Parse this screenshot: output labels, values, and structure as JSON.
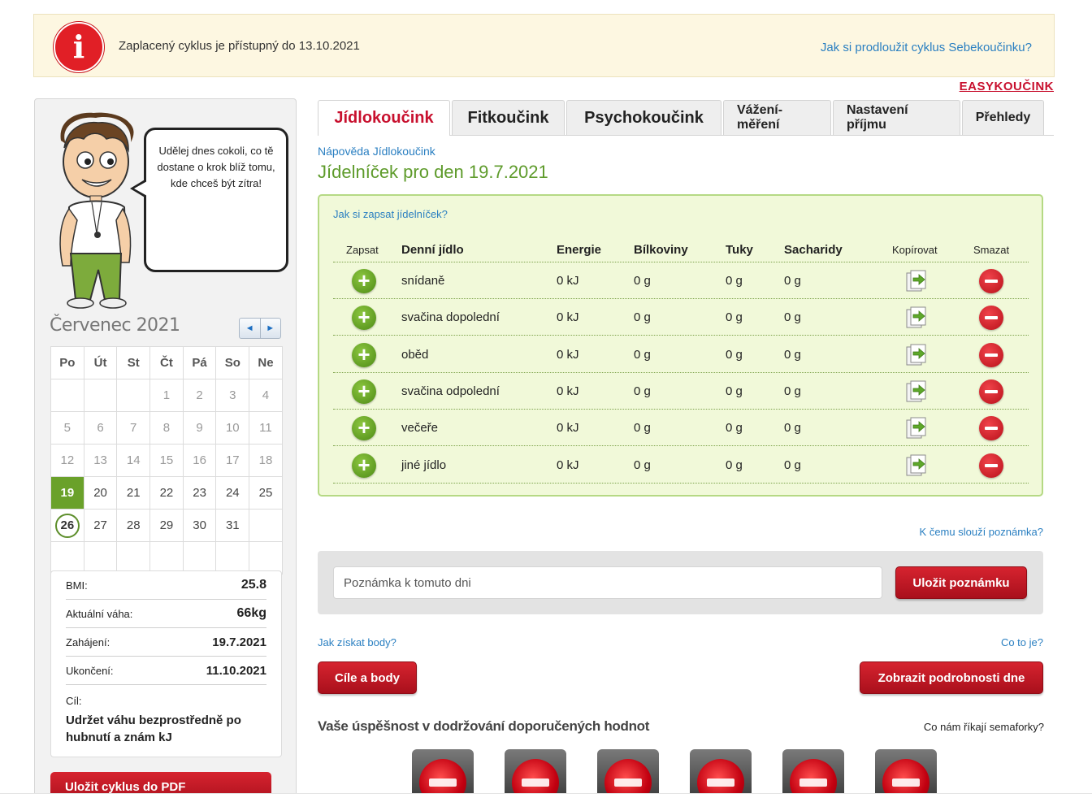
{
  "banner": {
    "icon": "info-icon",
    "icon_glyph": "i",
    "text": "Zaplacený cyklus je přístupný do 13.10.2021",
    "link": "Jak si prodloužit cyklus Sebekoučinku?"
  },
  "easy_link": "EASYKOUČINK",
  "coach": {
    "bubble": "Udělej dnes cokoli, co tě dostane o krok blíž tomu, kde chceš být zítra!"
  },
  "calendar": {
    "month": "Červenec 2021",
    "prev_glyph": "◄",
    "next_glyph": "►",
    "weekdays": [
      "Po",
      "Út",
      "St",
      "Čt",
      "Pá",
      "So",
      "Ne"
    ],
    "weeks": [
      [
        "",
        "",
        "",
        "1",
        "2",
        "3",
        "4"
      ],
      [
        "5",
        "6",
        "7",
        "8",
        "9",
        "10",
        "11"
      ],
      [
        "12",
        "13",
        "14",
        "15",
        "16",
        "17",
        "18"
      ],
      [
        "19",
        "20",
        "21",
        "22",
        "23",
        "24",
        "25"
      ],
      [
        "26",
        "27",
        "28",
        "29",
        "30",
        "31",
        ""
      ],
      [
        "",
        "",
        "",
        "",
        "",
        "",
        ""
      ]
    ],
    "selected_day": "19",
    "today": "26"
  },
  "stats": {
    "bmi_label": "BMI:",
    "bmi": "25.8",
    "weight_label": "Aktuální váha:",
    "weight": "66kg",
    "start_label": "Zahájení:",
    "start": "19.7.2021",
    "end_label": "Ukončení:",
    "end": "11.10.2021",
    "goal_label": "Cíl:",
    "goal": "Udržet váhu bezprostředně po hubnutí a znám kJ"
  },
  "pdf_button": "Uložit cyklus do PDF",
  "tabs": [
    "Jídlokoučink",
    "Fitkoučink",
    "Psychokoučink",
    "Vážení-měření",
    "Nastavení příjmu",
    "Přehledy"
  ],
  "help_link": "Nápověda Jídlokoučink",
  "menu_title": "Jídelníček pro den 19.7.2021",
  "food": {
    "help": "Jak si zapsat jídelníček?",
    "headers": {
      "add": "Zapsat",
      "meal": "Denní jídlo",
      "energy": "Energie",
      "protein": "Bílkoviny",
      "fat": "Tuky",
      "carbs": "Sacharidy",
      "copy": "Kopírovat",
      "delete": "Smazat"
    },
    "rows": [
      {
        "meal": "snídaně",
        "energy": "0 kJ",
        "protein": "0 g",
        "fat": "0 g",
        "carbs": "0 g"
      },
      {
        "meal": "svačina dopolední",
        "energy": "0 kJ",
        "protein": "0 g",
        "fat": "0 g",
        "carbs": "0 g"
      },
      {
        "meal": "oběd",
        "energy": "0 kJ",
        "protein": "0 g",
        "fat": "0 g",
        "carbs": "0 g"
      },
      {
        "meal": "svačina odpolední",
        "energy": "0 kJ",
        "protein": "0 g",
        "fat": "0 g",
        "carbs": "0 g"
      },
      {
        "meal": "večeře",
        "energy": "0 kJ",
        "protein": "0 g",
        "fat": "0 g",
        "carbs": "0 g"
      },
      {
        "meal": "jiné jídlo",
        "energy": "0 kJ",
        "protein": "0 g",
        "fat": "0 g",
        "carbs": "0 g"
      }
    ],
    "add_glyph": "+"
  },
  "note": {
    "help": "K čemu slouží poznámka?",
    "placeholder": "Poznámka k tomuto dni",
    "save": "Uložit poznámku"
  },
  "points": {
    "link": "Jak získat body?",
    "what_link": "Co to je?",
    "goals_button": "Cíle a body",
    "details_button": "Zobrazit podrobnosti dne"
  },
  "success": {
    "title": "Vaše úspěšnost v dodržování doporučených hodnot",
    "link": "Co nám říkají semaforky?",
    "lights": [
      "red",
      "red",
      "red",
      "red",
      "red",
      "red"
    ]
  }
}
